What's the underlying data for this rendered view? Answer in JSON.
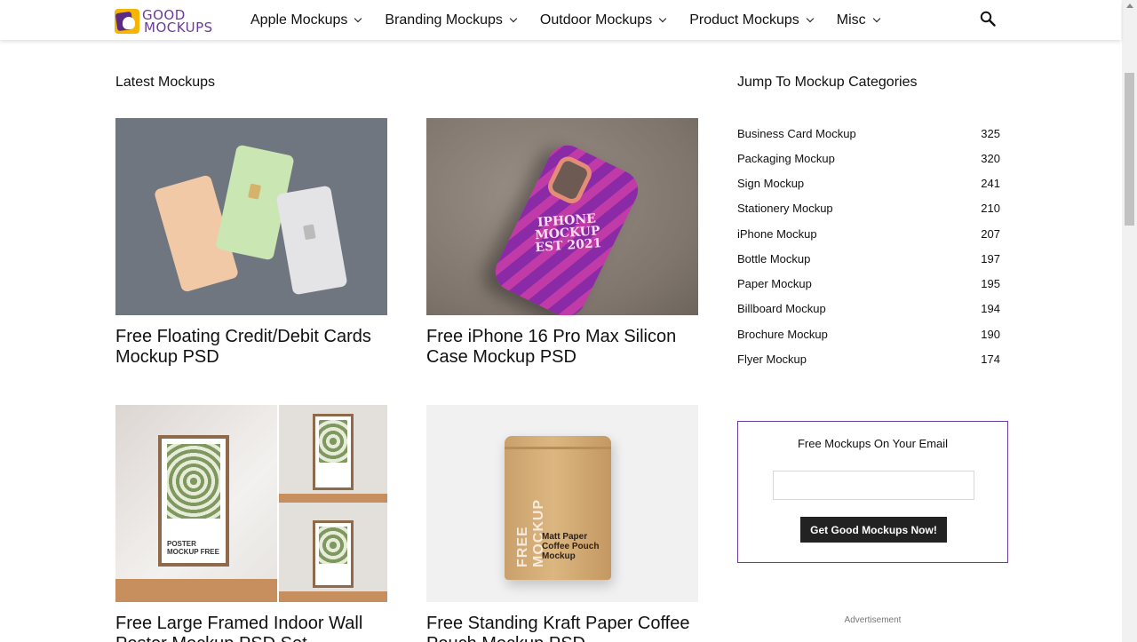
{
  "header": {
    "logo_line1": "GOOD",
    "logo_line2": "MOCKUPS",
    "nav": [
      {
        "label": "Apple Mockups"
      },
      {
        "label": "Branding Mockups"
      },
      {
        "label": "Outdoor Mockups"
      },
      {
        "label": "Product Mockups"
      },
      {
        "label": "Misc"
      }
    ],
    "search_icon": "search-icon"
  },
  "main": {
    "section_title": "Latest Mockups",
    "posts": [
      {
        "title": "Free Floating Credit/Debit Cards Mockup PSD"
      },
      {
        "title": "Free iPhone 16 Pro Max Silicon Case Mockup PSD",
        "image_text": "IPHONE MOCKUP EST 2021"
      },
      {
        "title": "Free Large Framed Indoor Wall Poster Mockup PSD Set",
        "image_text": "POSTER MOCKUP FREE"
      },
      {
        "title": "Free Standing Kraft Paper Coffee Pouch Mockup PSD",
        "image_text_vertical": "FREE MOCKUP",
        "image_text": "Matt Paper Coffee Pouch Mockup"
      }
    ]
  },
  "sidebar": {
    "categories_title": "Jump To Mockup Categories",
    "categories": [
      {
        "name": "Business Card Mockup",
        "count": "325"
      },
      {
        "name": "Packaging Mockup",
        "count": "320"
      },
      {
        "name": "Sign Mockup",
        "count": "241"
      },
      {
        "name": "Stationery Mockup",
        "count": "210"
      },
      {
        "name": "iPhone Mockup",
        "count": "207"
      },
      {
        "name": "Bottle Mockup",
        "count": "197"
      },
      {
        "name": "Paper Mockup",
        "count": "195"
      },
      {
        "name": "Billboard Mockup",
        "count": "194"
      },
      {
        "name": "Brochure Mockup",
        "count": "190"
      },
      {
        "name": "Flyer Mockup",
        "count": "174"
      }
    ],
    "signup": {
      "title": "Free Mockups On Your Email",
      "input_value": "",
      "button_label": "Get Good Mockups Now!"
    },
    "ad_label": "Advertisement"
  },
  "colors": {
    "brand_purple": "#6a3c9e",
    "brand_yellow": "#f5b500",
    "button_dark": "#222222"
  }
}
